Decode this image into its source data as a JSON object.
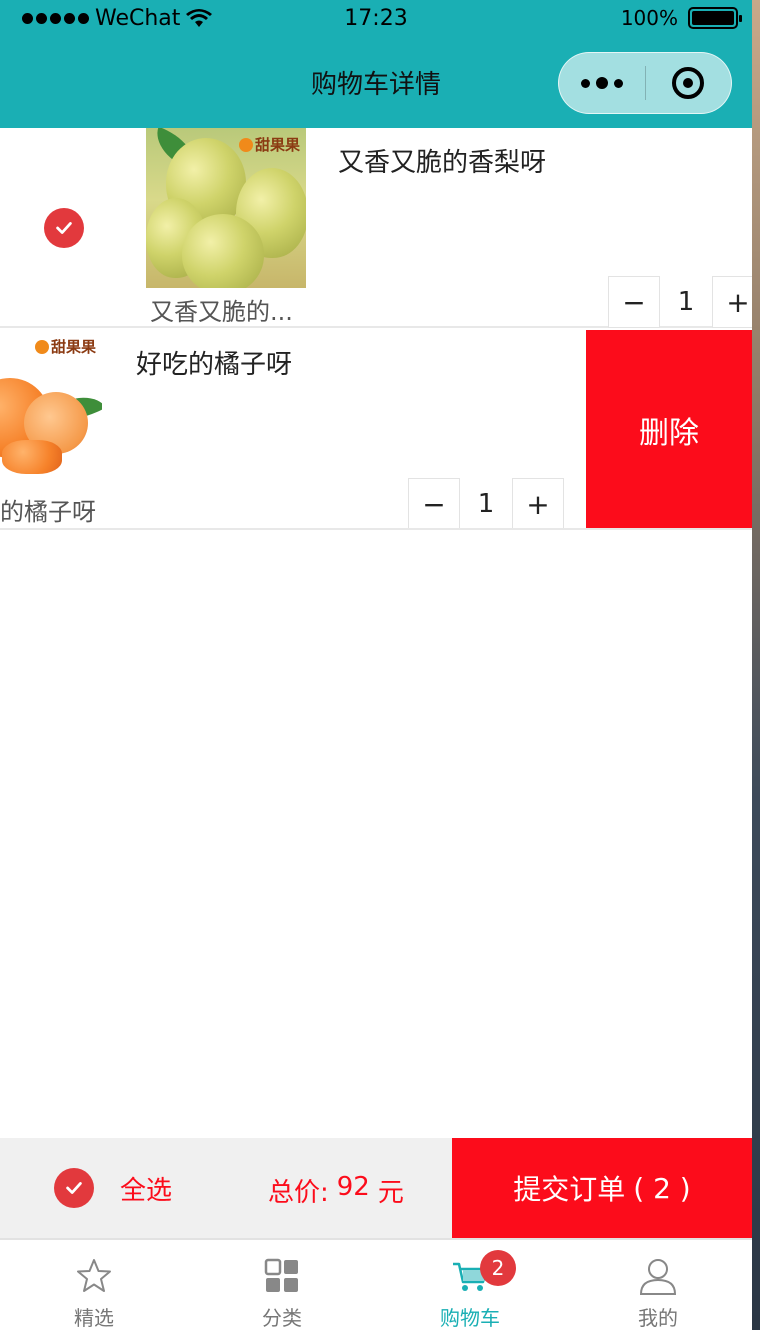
{
  "status_bar": {
    "carrier": "WeChat",
    "time": "17:23",
    "battery": "100%"
  },
  "nav": {
    "title": "购物车详情"
  },
  "cart": {
    "items": [
      {
        "title": "又香又脆的香梨呀",
        "caption": "又香又脆的...",
        "brand": "甜果果",
        "quantity": "1",
        "minus": "−",
        "plus": "+",
        "selected": true
      },
      {
        "title": "好吃的橘子呀",
        "caption": "的橘子呀",
        "brand": "甜果果",
        "quantity": "1",
        "minus": "−",
        "plus": "+",
        "delete_label": "删除"
      }
    ]
  },
  "footer": {
    "select_all_label": "全选",
    "total_label": "总价:",
    "total_value": "92",
    "total_unit": "元",
    "submit_label": "提交订单",
    "submit_count": "( 2 )"
  },
  "tabbar": {
    "tabs": [
      {
        "label": "精选",
        "icon": "star-icon"
      },
      {
        "label": "分类",
        "icon": "grid-icon"
      },
      {
        "label": "购物车",
        "icon": "cart-icon",
        "badge": "2",
        "active": true
      },
      {
        "label": "我的",
        "icon": "user-icon"
      }
    ]
  },
  "colors": {
    "primary": "#1aafb4",
    "danger": "#fc0c1b",
    "check": "#e2393d"
  }
}
